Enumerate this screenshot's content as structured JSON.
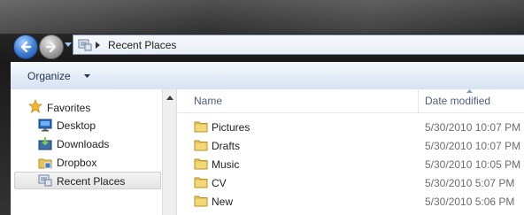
{
  "address_bar": {
    "location": "Recent Places"
  },
  "toolbar": {
    "organize_label": "Organize"
  },
  "navigation_pane": {
    "items": [
      {
        "label": "Favorites",
        "icon": "star-icon"
      },
      {
        "label": "Desktop",
        "icon": "desktop-icon"
      },
      {
        "label": "Downloads",
        "icon": "downloads-icon"
      },
      {
        "label": "Dropbox",
        "icon": "dropbox-icon"
      },
      {
        "label": "Recent Places",
        "icon": "recent-places-icon",
        "selected": true
      }
    ]
  },
  "file_list": {
    "columns": {
      "name": "Name",
      "date_modified": "Date modified"
    },
    "rows": [
      {
        "name": "Pictures",
        "date": "5/30/2010 10:07 PM"
      },
      {
        "name": "Drafts",
        "date": "5/30/2010 10:07 PM"
      },
      {
        "name": "Music",
        "date": "5/30/2010 10:05 PM"
      },
      {
        "name": "CV",
        "date": "5/30/2010 5:07 PM"
      },
      {
        "name": "New",
        "date": "5/30/2010 5:06 PM"
      }
    ]
  },
  "colors": {
    "folder": "#e8c35a",
    "header_text": "#4c607a",
    "accent": "#3b7bd0"
  }
}
